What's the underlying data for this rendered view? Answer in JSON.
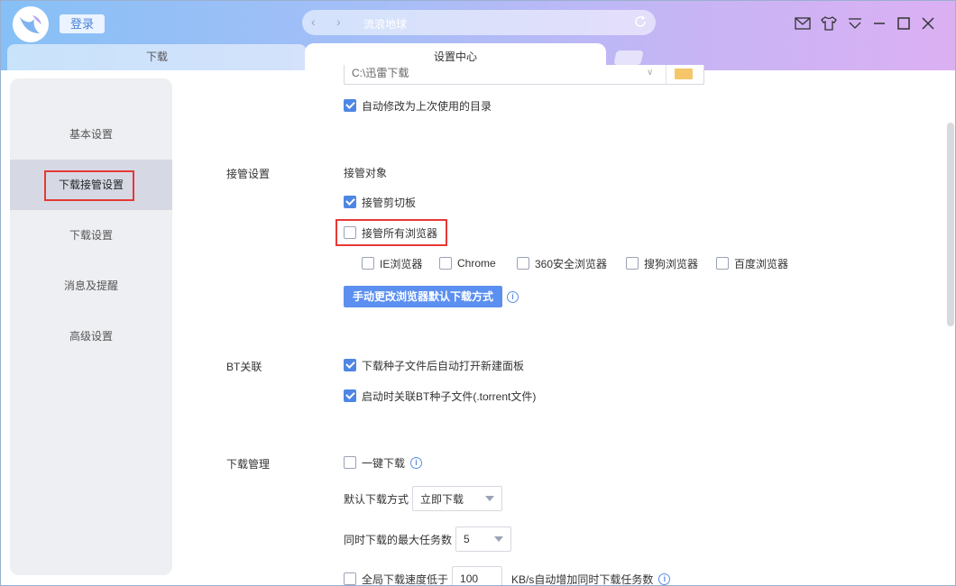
{
  "header": {
    "login_label": "登录",
    "address_text": "流浪地球"
  },
  "tabs": [
    {
      "label": "下载"
    },
    {
      "label": "设置中心"
    }
  ],
  "sidebar": {
    "items": [
      {
        "label": "基本设置"
      },
      {
        "label": "下载接管设置",
        "active": true
      },
      {
        "label": "下载设置"
      },
      {
        "label": "消息及提醒"
      },
      {
        "label": "高级设置"
      }
    ]
  },
  "download_dir": {
    "path_value": "C:\\迅雷下载",
    "auto_modify_label": "自动修改为上次使用的目录",
    "auto_modify_checked": true
  },
  "takeover": {
    "section_label": "接管设置",
    "target_label": "接管对象",
    "clipboard_label": "接管剪切板",
    "clipboard_checked": true,
    "all_browsers_label": "接管所有浏览器",
    "all_browsers_checked": false,
    "browsers": [
      {
        "label": "IE浏览器",
        "checked": false
      },
      {
        "label": "Chrome",
        "checked": false
      },
      {
        "label": "360安全浏览器",
        "checked": false
      },
      {
        "label": "搜狗浏览器",
        "checked": false
      },
      {
        "label": "百度浏览器",
        "checked": false
      }
    ],
    "manual_button_label": "手动更改浏览器默认下载方式"
  },
  "bt": {
    "section_label": "BT关联",
    "auto_open_label": "下载种子文件后自动打开新建面板",
    "auto_open_checked": true,
    "associate_label": "启动时关联BT种子文件(.torrent文件)",
    "associate_checked": true
  },
  "download_mgmt": {
    "section_label": "下载管理",
    "one_click_label": "一键下载",
    "one_click_checked": false,
    "default_mode_label": "默认下载方式",
    "default_mode_value": "立即下载",
    "max_tasks_label": "同时下载的最大任务数",
    "max_tasks_value": "5",
    "speed_prefix": "全局下载速度低于",
    "speed_value": "100",
    "speed_suffix": "KB/s自动增加同时下载任务数",
    "speed_checked": false
  },
  "colors": {
    "accent": "#5b8ff0",
    "highlight_box": "#e53935"
  }
}
